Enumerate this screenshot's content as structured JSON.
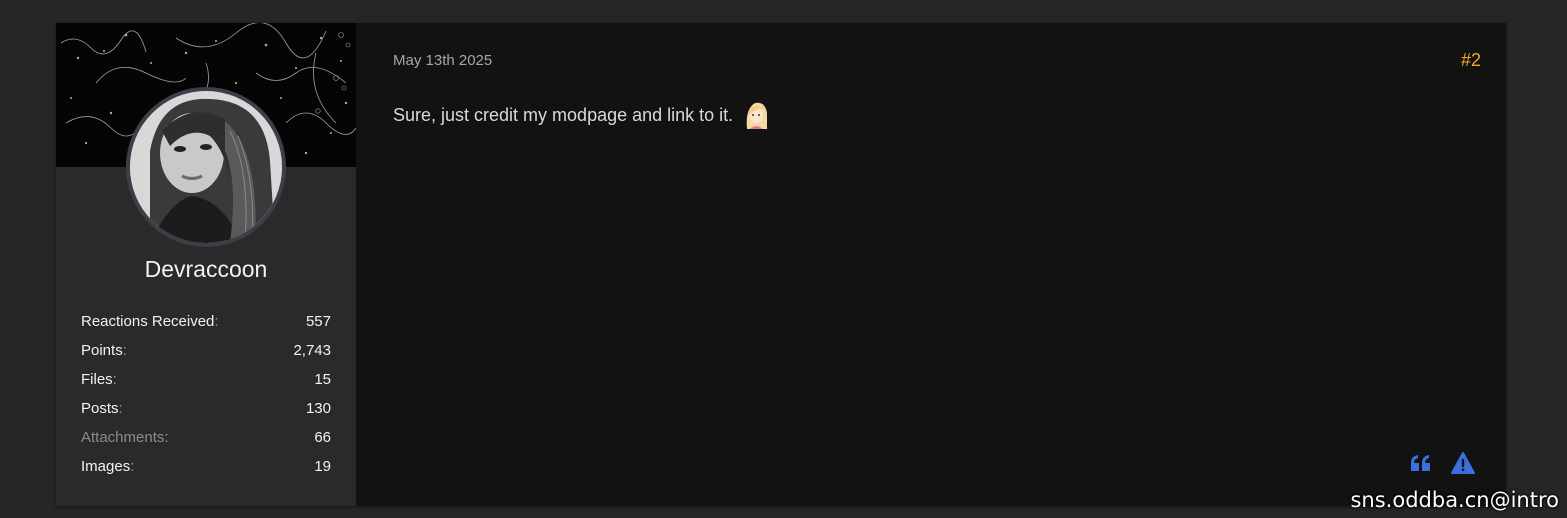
{
  "user": {
    "name": "Devraccoon",
    "stats": [
      {
        "label": "Reactions Received",
        "value": "557",
        "muted": false
      },
      {
        "label": "Points",
        "value": "2,743",
        "muted": false
      },
      {
        "label": "Files",
        "value": "15",
        "muted": false
      },
      {
        "label": "Posts",
        "value": "130",
        "muted": false
      },
      {
        "label": "Attachments",
        "value": "66",
        "muted": true
      },
      {
        "label": "Images",
        "value": "19",
        "muted": false
      }
    ]
  },
  "post": {
    "date": "May 13th 2025",
    "number": "#2",
    "body": "Sure, just credit my modpage and link to it.",
    "smiley_icon": "anime-girl-smiley-icon"
  },
  "actions": {
    "quote_icon": "quote-icon",
    "report_icon": "warning-triangle-icon"
  },
  "colors": {
    "accent": "#f5a623",
    "action_blue": "#3b6fe0",
    "background": "#262626",
    "post_bg": "#121212",
    "sidebar_bg": "#2a2a2a"
  },
  "watermark": "sns.oddba.cn@intro"
}
